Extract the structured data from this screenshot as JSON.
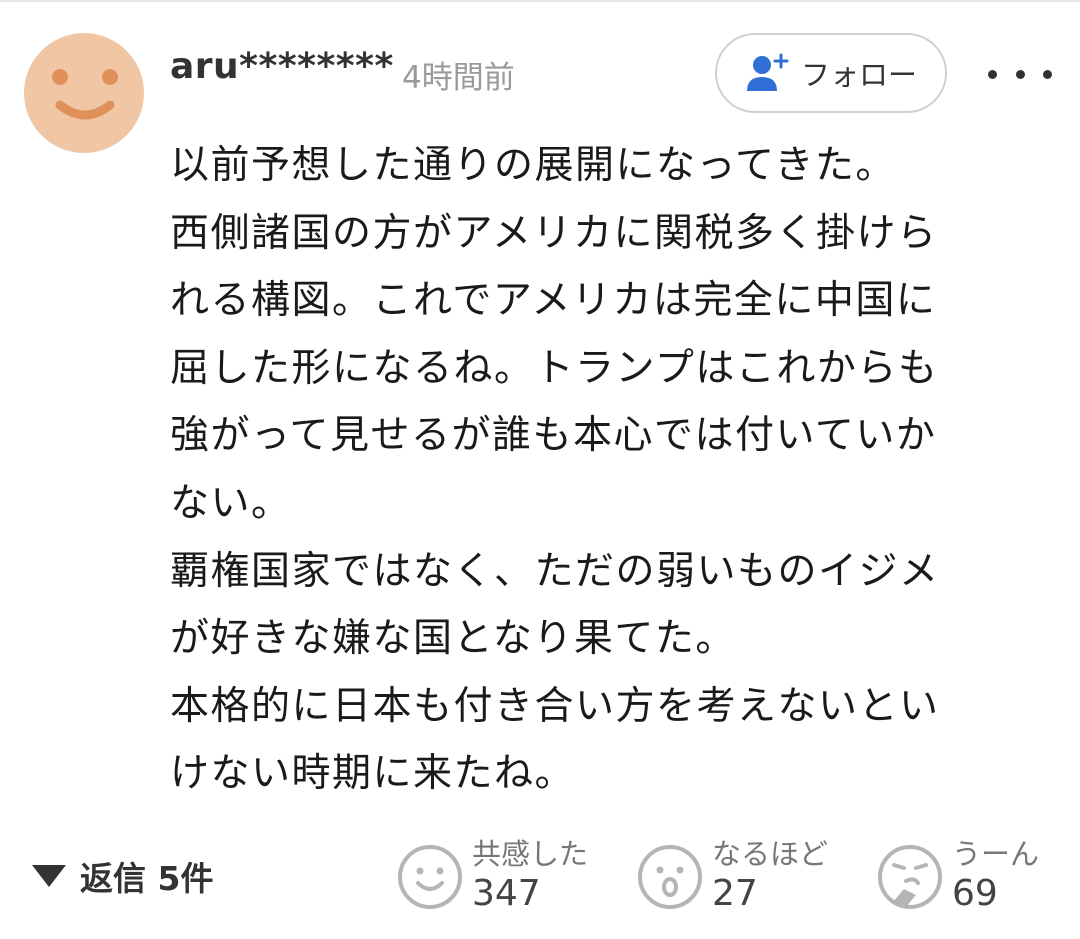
{
  "comment": {
    "username": "aru********",
    "timestamp": "4時間前",
    "follow_label": "フォロー",
    "body_lines": [
      "以前予想した通りの展開になってきた。",
      "西側諸国の方がアメリカに関税多く掛けら",
      "れる構図。これでアメリカは完全に中国に",
      "屈した形になるね。トランプはこれからも",
      "強がって見せるが誰も本心では付いていか",
      "ない。",
      "覇権国家ではなく、ただの弱いものイジメ",
      "が好きな嫌な国となり果てた。",
      "本格的に日本も付き合い方を考えないとい",
      "けない時期に来たね。"
    ],
    "replies_label": "返信 5件",
    "reactions": [
      {
        "icon": "smile-face-icon",
        "label": "共感した",
        "count": "347"
      },
      {
        "icon": "surprised-face-icon",
        "label": "なるほど",
        "count": "27"
      },
      {
        "icon": "thinking-face-icon",
        "label": "うーん",
        "count": "69"
      }
    ],
    "colors": {
      "avatar_bg": "#f0c6a4",
      "avatar_feature": "#e0915a",
      "accent_blue": "#2f6fd6",
      "icon_gray": "#b5b5b5"
    }
  }
}
